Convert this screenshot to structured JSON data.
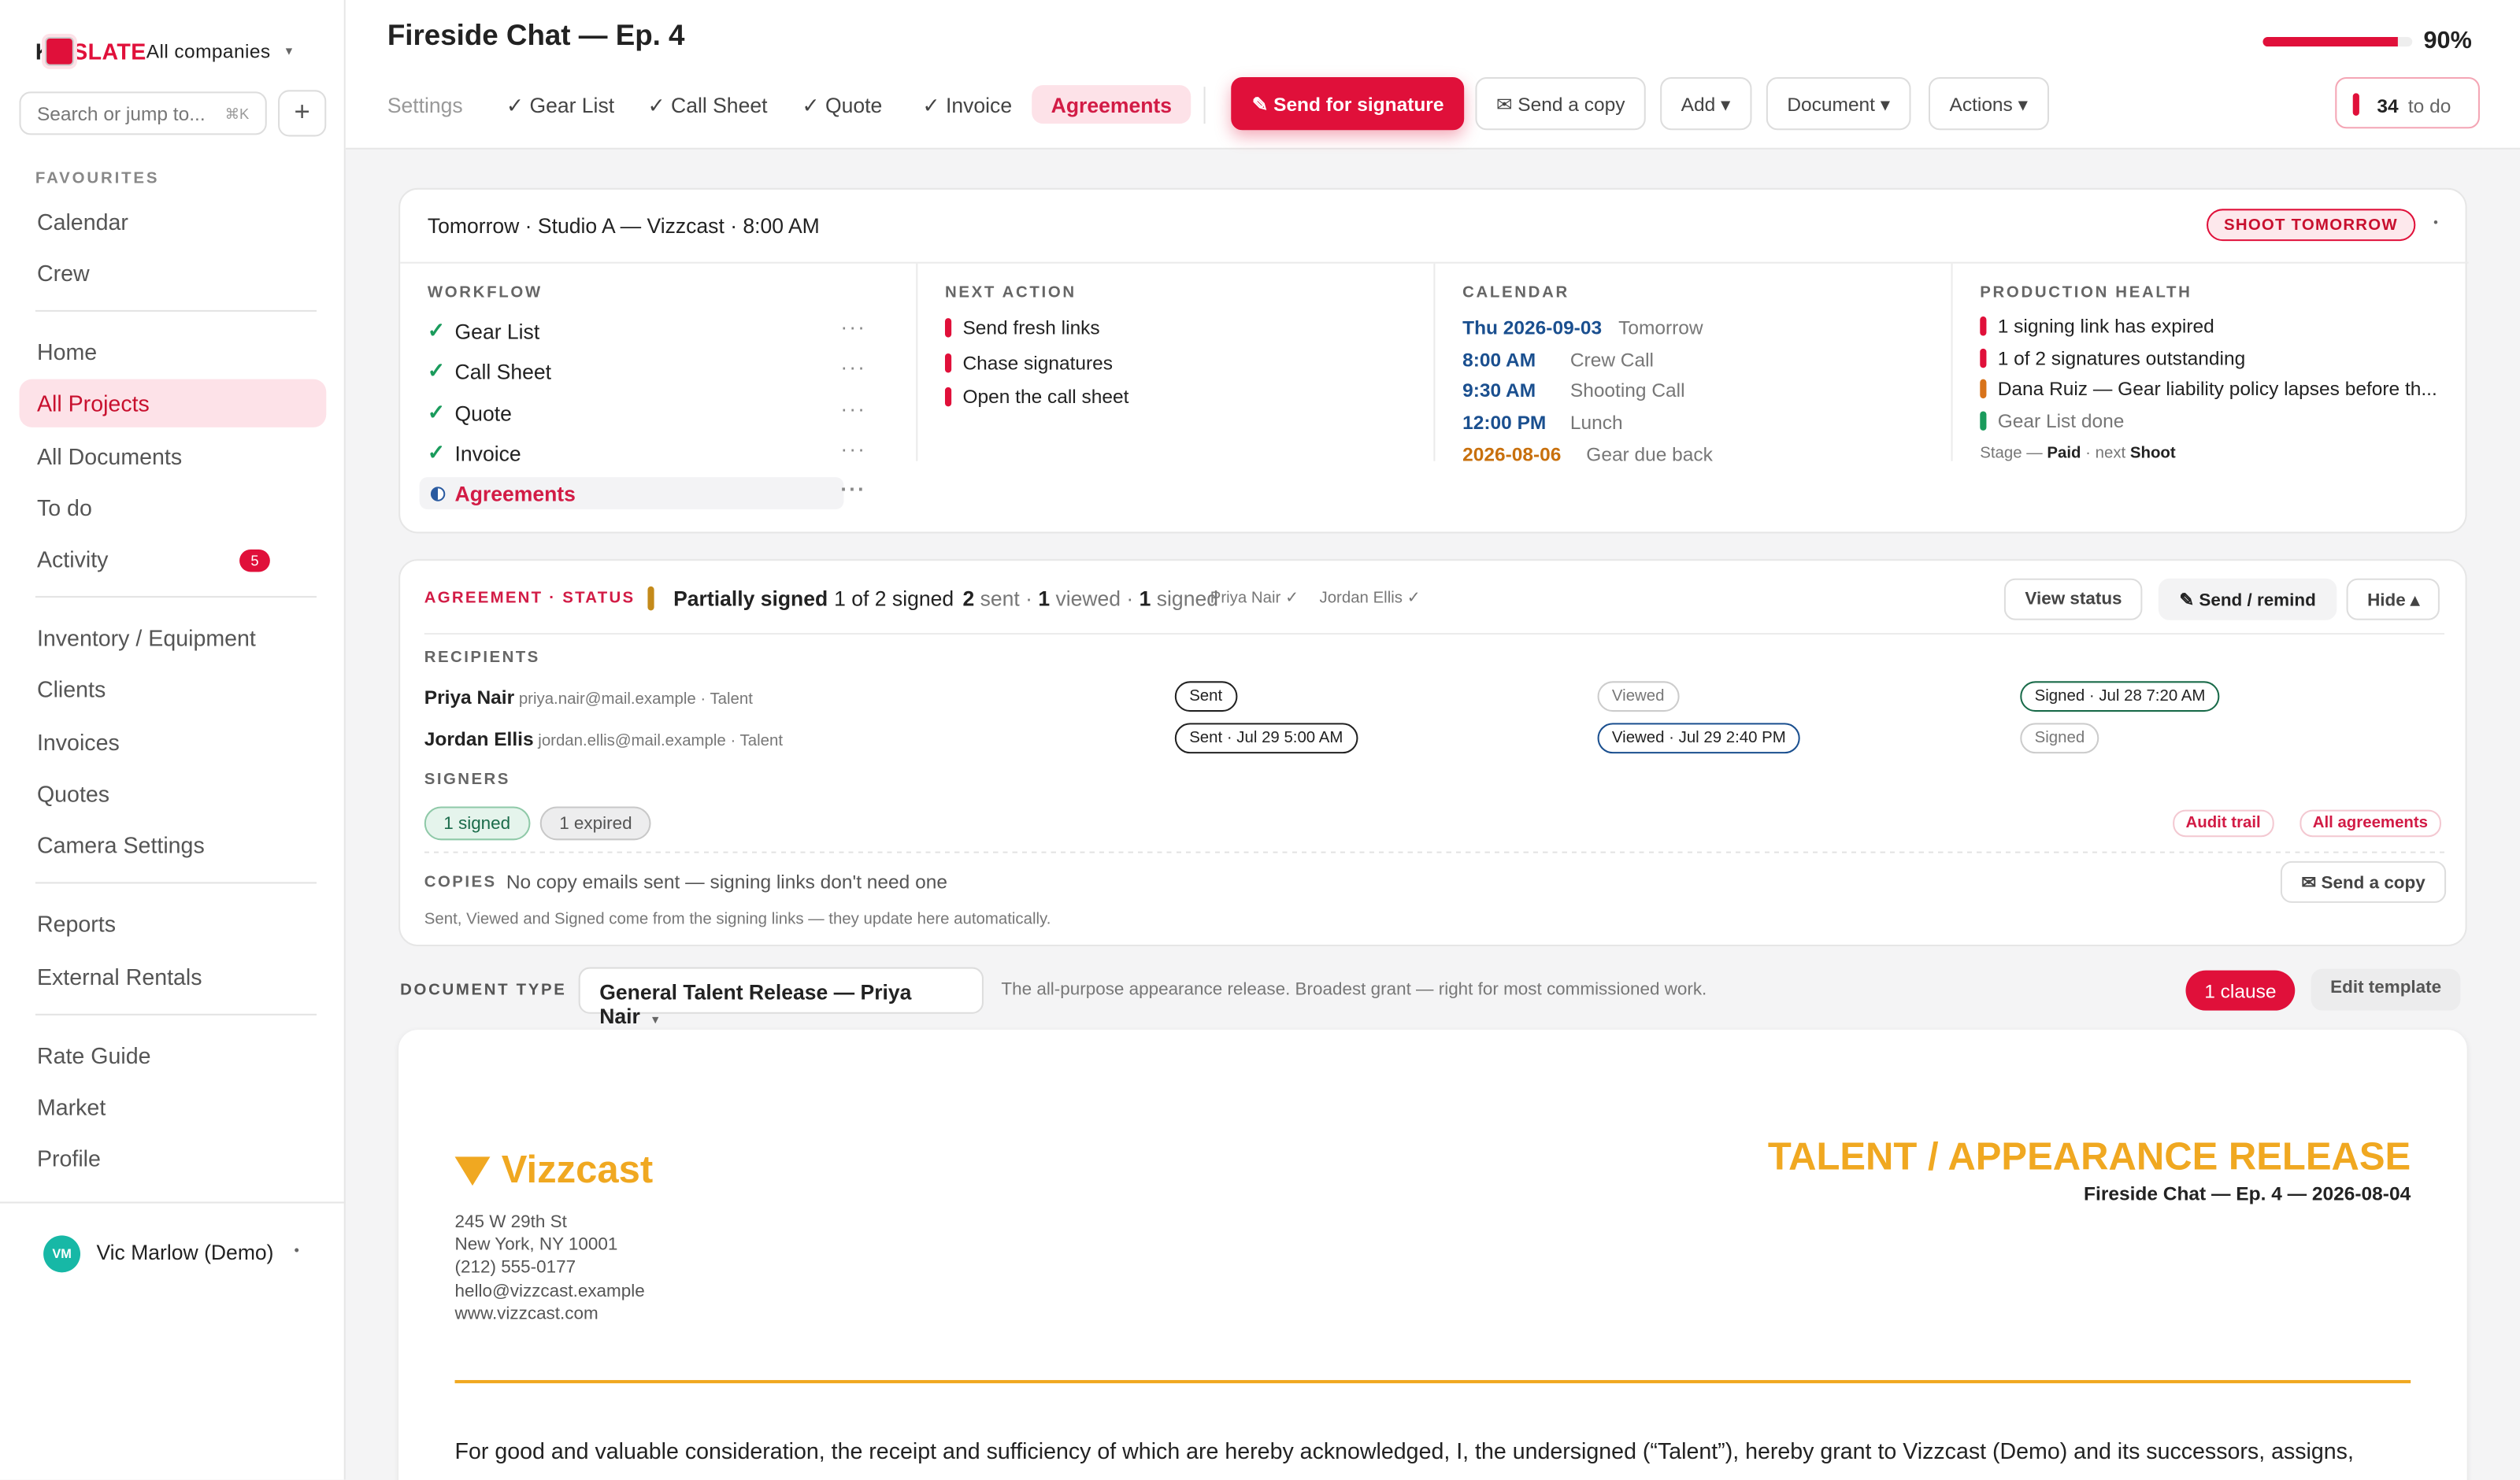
{
  "brand": {
    "kit": "KIT",
    "slate": "SLATE",
    "company": "All companies"
  },
  "search": {
    "placeholder": "Search or jump to...",
    "shortcut": "⌘K"
  },
  "sidebar": {
    "favourites_label": "FAVOURITES",
    "favourites": [
      "Calendar",
      "Crew"
    ],
    "group1": [
      "Home",
      "All Projects",
      "All Documents",
      "To do",
      "Activity"
    ],
    "activity_badge": "5",
    "group2": [
      "Inventory / Equipment",
      "Clients",
      "Invoices",
      "Quotes",
      "Camera Settings"
    ],
    "group3": [
      "Reports",
      "External Rentals"
    ],
    "group4": [
      "Rate Guide",
      "Market",
      "Profile"
    ],
    "user": {
      "initials": "VM",
      "name": "Vic Marlow (Demo)"
    }
  },
  "header": {
    "title": "Fireside Chat — Ep. 4",
    "progress": 0.9,
    "progress_label": "90%",
    "tabs": [
      "Settings",
      "✓ Gear List",
      "✓ Call Sheet",
      "✓ Quote",
      "✓ Invoice",
      "Agreements"
    ],
    "send_signature": "✎ Send for signature",
    "send_copy": "✉ Send a copy",
    "add": "Add ▾",
    "document": "Document ▾",
    "actions": "Actions ▾",
    "todo_count": "34",
    "todo_label": "to do"
  },
  "overview": {
    "title": "Tomorrow · Studio A — Vizzcast · 8:00 AM",
    "status": "SHOOT TOMORROW",
    "workflow_label": "WORKFLOW",
    "workflow": [
      "Gear List",
      "Call Sheet",
      "Quote",
      "Invoice",
      "Agreements"
    ],
    "next_label": "NEXT ACTION",
    "next": [
      "Send fresh links",
      "Chase signatures",
      "Open the call sheet"
    ],
    "calendar_label": "CALENDAR",
    "calendar": [
      {
        "time": "Thu 2026-09-03",
        "label": "Tomorrow"
      },
      {
        "time": "8:00 AM",
        "label": "Crew Call"
      },
      {
        "time": "9:30 AM",
        "label": "Shooting Call"
      },
      {
        "time": "12:00 PM",
        "label": "Lunch"
      },
      {
        "time": "2026-08-06",
        "label": "Gear due back"
      }
    ],
    "health_label": "PRODUCTION HEALTH",
    "health": [
      {
        "text": "1 signing link has expired",
        "color": "#e0103a"
      },
      {
        "text": "1 of 2 signatures outstanding",
        "color": "#e0103a"
      },
      {
        "text": "Dana Ruiz — Gear liability policy lapses before th...",
        "color": "#d8731a"
      },
      {
        "text": "Gear List done",
        "color": "#1a9b5c"
      }
    ],
    "stage_prefix": "Stage — ",
    "stage_paid": "Paid",
    "stage_mid": " · next ",
    "stage_next": "Shoot"
  },
  "agreement": {
    "label": "AGREEMENT · STATUS",
    "state": "Partially signed",
    "count": "1 of 2 signed",
    "sent_n": "2",
    "sent": " sent · ",
    "viewed_n": "1",
    "viewed": " viewed · ",
    "signed_n": "1",
    "signed": " signed",
    "p1": "Priya Nair ✓",
    "p2": "Jordan Ellis ✓",
    "view_status": "View status",
    "send_remind": "✎ Send / remind",
    "hide": "Hide ▴",
    "recipients_label": "RECIPIENTS",
    "recipients": [
      {
        "name": "Priya Nair",
        "meta": " priya.nair@mail.example · Talent",
        "sent": "Sent",
        "viewed": "Viewed",
        "signed": "Signed · Jul 28 7:20 AM"
      },
      {
        "name": "Jordan Ellis",
        "meta": " jordan.ellis@mail.example · Talent",
        "sent": "Sent · Jul 29 5:00 AM",
        "viewed": "Viewed · Jul 29 2:40 PM",
        "signed": "Signed"
      }
    ],
    "signers_label": "SIGNERS",
    "signed_pill": "1 signed",
    "expired_pill": "1 expired",
    "audit": "Audit trail",
    "all_agreements": "All agreements",
    "copies_label": "COPIES",
    "copies_text": "No copy emails sent — signing links don't need one",
    "send_copy": "✉ Send a copy",
    "footnote": "Sent, Viewed and Signed come from the signing links — they update here automatically."
  },
  "doctype": {
    "label": "DOCUMENT TYPE",
    "select": "General Talent Release — Priya Nair",
    "desc": "The all-purpose appearance release. Broadest grant — right for most commissioned work.",
    "clause": "1 clause",
    "edit": "Edit template"
  },
  "document": {
    "logo": "Vizzcast",
    "address": [
      "245 W 29th St",
      "New York, NY 10001",
      "(212) 555-0177",
      "hello@vizzcast.example",
      "www.vizzcast.com"
    ],
    "title": "TALENT / APPEARANCE RELEASE",
    "subtitle": "Fireside Chat — Ep. 4 — 2026-08-04",
    "body": "For good and valuable consideration, the receipt and sufficiency of which are hereby acknowledged, I, the undersigned (“Talent”), hereby grant to Vizzcast (Demo) and its successors, assigns,"
  }
}
